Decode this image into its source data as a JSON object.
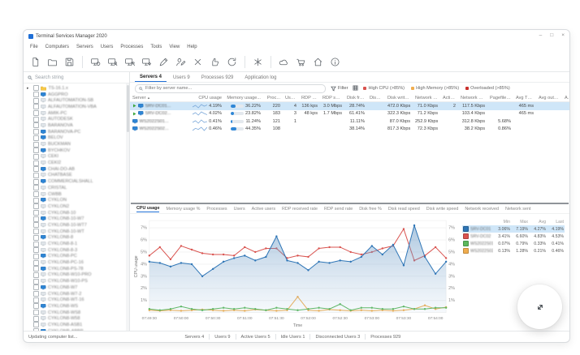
{
  "window": {
    "title": "Terminal Services Manager 2020",
    "controls": {
      "minimize": "–",
      "maximize": "□",
      "close": "×"
    }
  },
  "menu": {
    "items": [
      "File",
      "Computers",
      "Servers",
      "Users",
      "Processes",
      "Tools",
      "View",
      "Help"
    ]
  },
  "toolbar": {
    "groups": [
      [
        "new-document-icon",
        "open-folder-icon",
        "save-icon"
      ],
      [
        "computer-refresh-icon",
        "computer-user-icon",
        "computer-users-icon",
        "computer-settings-icon",
        "edit-pencil-icon",
        "user-edit-icon",
        "delete-x-icon",
        "thumb-up-icon",
        "refresh-icon"
      ],
      [
        "kill-process-icon"
      ],
      [
        "cloud-icon",
        "cart-icon",
        "home-icon",
        "info-icon"
      ]
    ]
  },
  "left_panel": {
    "search_placeholder": "Search string",
    "root_label": "TS-16.1.x",
    "computers": [
      {
        "name": "AGGPRO",
        "online": true
      },
      {
        "name": "ALFAUTOMATION-SB",
        "online": false
      },
      {
        "name": "ALFAUTOMATION-VBA",
        "online": false
      },
      {
        "name": "AMIK-PC",
        "online": false
      },
      {
        "name": "AUTODESK",
        "online": false
      },
      {
        "name": "BARANOVA",
        "online": false
      },
      {
        "name": "BARANOVA-PC",
        "online": true
      },
      {
        "name": "BELOV",
        "online": true
      },
      {
        "name": "BUCKMAN",
        "online": false
      },
      {
        "name": "BYCHKOV",
        "online": true
      },
      {
        "name": "CEKI",
        "online": false
      },
      {
        "name": "CEKI2",
        "online": false
      },
      {
        "name": "CHAI-DO-AB",
        "online": true
      },
      {
        "name": "CHATBASE",
        "online": false
      },
      {
        "name": "COMMERCIALSHALL",
        "online": true
      },
      {
        "name": "CRISTAL",
        "online": false
      },
      {
        "name": "CWBB",
        "online": false
      },
      {
        "name": "CYKLON",
        "online": true
      },
      {
        "name": "CYKLON2",
        "online": false
      },
      {
        "name": "CYKLON8-10",
        "online": false
      },
      {
        "name": "CYKLON8-10-W7",
        "online": true
      },
      {
        "name": "CYKLON8-10-WT7",
        "online": false
      },
      {
        "name": "CYKLON8-10-WT",
        "online": false
      },
      {
        "name": "CYKLON8-8",
        "online": true
      },
      {
        "name": "CYKLON8-8-1",
        "online": false
      },
      {
        "name": "CYKLON8-8-3",
        "online": false
      },
      {
        "name": "CYKLON8-PC",
        "online": true
      },
      {
        "name": "CYKLON8-PC-16",
        "online": false
      },
      {
        "name": "CYKLON8-PS-78",
        "online": true
      },
      {
        "name": "CYKLON8-W10-PRO",
        "online": false
      },
      {
        "name": "CYKLON8-W10-PS",
        "online": false
      },
      {
        "name": "CYKLON8-W7",
        "online": true
      },
      {
        "name": "CYKLON8-W7-2",
        "online": false
      },
      {
        "name": "CYKLON8-WT-16",
        "online": false
      },
      {
        "name": "CYKLON8-WS",
        "online": true
      },
      {
        "name": "CYKLON8-WS8",
        "online": false
      },
      {
        "name": "CYKLON8-W58",
        "online": false
      },
      {
        "name": "CYKLON8-ASB1",
        "online": false
      },
      {
        "name": "CYKLONB-ABBP",
        "online": true
      },
      {
        "name": "CYKLONB2",
        "online": false
      }
    ]
  },
  "tabs": [
    {
      "label": "Servers 4",
      "active": true
    },
    {
      "label": "Users 9",
      "active": false
    },
    {
      "label": "Processes 929",
      "active": false
    },
    {
      "label": "Application log",
      "active": false
    }
  ],
  "filter_row": {
    "placeholder": "Filter by server name...",
    "filter_label": "Filter",
    "chips": [
      {
        "label": "High CPU (>85%)",
        "color": "#d9534f"
      },
      {
        "label": "High Memory (>85%)",
        "color": "#f0ad4e"
      },
      {
        "label": "Overloaded (>85%)",
        "color": "#c9302c"
      }
    ]
  },
  "server_table": {
    "columns": [
      "Server",
      "CPU usage",
      "Memory usage...",
      "Proc...",
      "Users",
      "RDP re...",
      "RDP sen...",
      "Disk free...",
      "Disk re...",
      "Disk write...",
      "Network re...",
      "Active se...",
      "Network sent",
      "Pagefile usage...",
      "Avg TCP RTT",
      "Avg output FPS",
      "Avg input..."
    ],
    "rows": [
      {
        "name": "SRV-DC01",
        "running": true,
        "selected": true,
        "spark": [
          3.8,
          4.2,
          3.6,
          4.4,
          4.0,
          4.3
        ],
        "cpu": "4.19%",
        "mem": "36.22%",
        "mem_pct": 36,
        "proc": "220",
        "users": "4",
        "rdp_re": "136 kps",
        "rdp_sen": "3.0 Mbps",
        "disk_free": "28.74%",
        "disk_re": "",
        "disk_write": "472.0 Kbps",
        "net_re": "71.0 Kbps",
        "active_se": "2",
        "net_sent": "117.5 Kbps",
        "pagefile": "",
        "rtt": "465 ms",
        "fps": "",
        "input": ""
      },
      {
        "name": "SRV-DC02",
        "running": true,
        "selected": false,
        "spark": [
          4.6,
          5.0,
          4.4,
          5.2,
          4.8,
          4.5
        ],
        "cpu": "4.02%",
        "mem": "23.82%",
        "mem_pct": 24,
        "proc": "183",
        "users": "3",
        "rdp_re": "48 kps",
        "rdp_sen": "1.7 Mbps",
        "disk_free": "61.41%",
        "disk_re": "",
        "disk_write": "322.3 Kbps",
        "net_re": "71.2 Kbps",
        "active_se": "",
        "net_sent": "103.4 Kbps",
        "pagefile": "",
        "rtt": "465 ms",
        "fps": "",
        "input": ""
      },
      {
        "name": "WS2022S01",
        "running": false,
        "selected": false,
        "spark": [
          0.3,
          0.5,
          0.2,
          0.6,
          0.3,
          0.4
        ],
        "cpu": "0.41%",
        "mem": "11.24%",
        "mem_pct": 11,
        "proc": "121",
        "users": "1",
        "rdp_re": "",
        "rdp_sen": "",
        "disk_free": "11.11%",
        "disk_re": "",
        "disk_write": "87.0 Kbps",
        "net_re": "252.9 Kbps",
        "active_se": "",
        "net_sent": "312.8 Kbps",
        "pagefile": "5.68%",
        "rtt": "",
        "fps": "",
        "input": ""
      },
      {
        "name": "WS2022S02",
        "running": false,
        "selected": false,
        "spark": [
          0.2,
          0.4,
          0.3,
          0.5,
          0.2,
          0.5
        ],
        "cpu": "0.46%",
        "mem": "44.35%",
        "mem_pct": 44,
        "proc": "108",
        "users": "",
        "rdp_re": "",
        "rdp_sen": "",
        "disk_free": "38.14%",
        "disk_re": "",
        "disk_write": "817.3 Kbps",
        "net_re": "72.3 Kbps",
        "active_se": "",
        "net_sent": "38.2 Kbps",
        "pagefile": "0.86%",
        "rtt": "",
        "fps": "",
        "input": ""
      }
    ]
  },
  "chart_tabs": [
    {
      "label": "CPU usage",
      "active": true
    },
    {
      "label": "Memory usage %",
      "active": false
    },
    {
      "label": "Processes",
      "active": false
    },
    {
      "label": "Users",
      "active": false
    },
    {
      "label": "Active users",
      "active": false
    },
    {
      "label": "RDP received rate",
      "active": false
    },
    {
      "label": "RDP send rate",
      "active": false
    },
    {
      "label": "Disk free %",
      "active": false
    },
    {
      "label": "Disk read speed",
      "active": false
    },
    {
      "label": "Disk write speed",
      "active": false
    },
    {
      "label": "Network received",
      "active": false
    },
    {
      "label": "Network sent",
      "active": false
    }
  ],
  "chart_data": {
    "type": "line",
    "title": "",
    "xlabel": "Time",
    "ylabel": "CPU usage",
    "ylim": [
      0,
      7.6
    ],
    "yticks": [
      1,
      2,
      3,
      4,
      5,
      6,
      7
    ],
    "ytick_suffix": "%",
    "grid": true,
    "legend_position": "right",
    "tick_labels": [
      "07:49:30",
      "07:50:00",
      "07:50:30",
      "07:51:00",
      "07:51:30",
      "07:52:00",
      "07:52:30",
      "07:53:00",
      "07:53:30",
      "07:54:00"
    ],
    "tick_every_points": 3,
    "series": [
      {
        "name": "SRV-DC01",
        "color": "#2e75b6",
        "fill": true,
        "values": [
          4.2,
          4.1,
          3.8,
          4.1,
          4.0,
          3.0,
          3.6,
          4.2,
          4.5,
          4.7,
          4.3,
          4.6,
          6.3,
          4.3,
          4.1,
          3.5,
          4.2,
          4.1,
          4.3,
          4.2,
          4.6,
          5.5,
          4.8,
          5.6,
          3.9,
          7.2,
          4.6,
          3.2,
          4.2
        ],
        "stats": {
          "min": "3.06%",
          "max": "7.19%",
          "avg": "4.27%",
          "last": "4.19%"
        },
        "selected": true
      },
      {
        "name": "SRV-DC02",
        "color": "#d9534f",
        "fill": false,
        "values": [
          4.7,
          5.4,
          4.4,
          5.5,
          5.2,
          4.9,
          4.8,
          4.8,
          4.7,
          5.4,
          5.0,
          5.3,
          5.3,
          4.5,
          4.7,
          4.6,
          5.3,
          5.4,
          5.4,
          5.0,
          4.8,
          5.0,
          5.3,
          5.5,
          6.9,
          4.3,
          4.7,
          5.4,
          4.5
        ],
        "stats": {
          "min": "3.41%",
          "max": "6.60%",
          "avg": "4.83%",
          "last": "4.53%"
        },
        "selected": false
      },
      {
        "name": "WS2022S01",
        "color": "#5cb85c",
        "fill": false,
        "values": [
          0.3,
          0.2,
          0.3,
          0.5,
          0.3,
          0.2,
          0.3,
          0.4,
          0.3,
          0.4,
          0.3,
          0.2,
          0.4,
          0.3,
          0.2,
          0.3,
          0.4,
          0.3,
          0.7,
          0.2,
          0.4,
          0.4,
          0.3,
          0.3,
          0.5,
          0.3,
          0.3,
          0.4,
          0.4
        ],
        "stats": {
          "min": "0.07%",
          "max": "0.79%",
          "avg": "0.33%",
          "last": "0.41%"
        },
        "selected": false
      },
      {
        "name": "WS2022S02",
        "color": "#f0ad4e",
        "fill": false,
        "values": [
          0.2,
          0.15,
          0.2,
          0.15,
          0.2,
          0.25,
          0.2,
          0.15,
          0.2,
          0.15,
          0.25,
          0.2,
          0.15,
          0.2,
          1.3,
          0.2,
          0.15,
          0.25,
          0.2,
          0.15,
          0.2,
          0.15,
          0.2,
          0.15,
          0.2,
          0.3,
          0.6,
          0.3,
          0.45
        ],
        "stats": {
          "min": "0.13%",
          "max": "1.28%",
          "avg": "0.21%",
          "last": "0.46%"
        },
        "selected": false
      }
    ]
  },
  "legend": {
    "columns": [
      "Min",
      "Max",
      "Avg",
      "Last"
    ]
  },
  "status_bar": {
    "left": "Updating computer list...",
    "items": [
      "Servers 4",
      "Users 9",
      "Active Users 5",
      "Idle Users 1",
      "Disconnected Users 3",
      "Processes 929"
    ]
  }
}
